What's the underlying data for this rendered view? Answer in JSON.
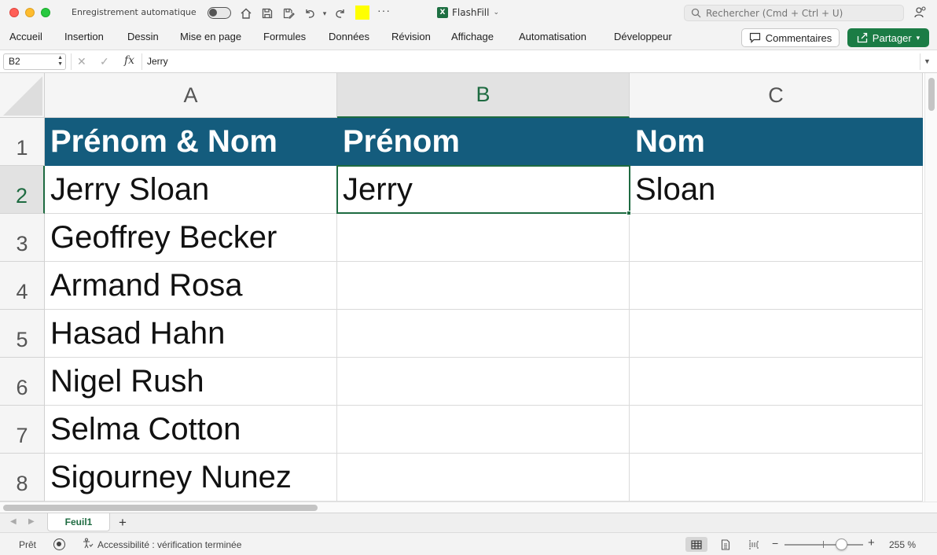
{
  "titlebar": {
    "autosave_label": "Enregistrement automatique",
    "doc_title": "FlashFill",
    "search_placeholder": "Rechercher (Cmd + Ctrl + U)",
    "highlight_color": "#ffff00"
  },
  "ribbon": {
    "tabs": [
      "Accueil",
      "Insertion",
      "Dessin",
      "Mise en page",
      "Formules",
      "Données",
      "Révision",
      "Affichage",
      "Automatisation",
      "Développeur"
    ],
    "comments_label": "Commentaires",
    "share_label": "Partager"
  },
  "formula_bar": {
    "name_box": "B2",
    "fx": "fx",
    "value": "Jerry"
  },
  "grid": {
    "columns": [
      "A",
      "B",
      "C"
    ],
    "rows": [
      "1",
      "2",
      "3",
      "4",
      "5",
      "6",
      "7",
      "8"
    ],
    "selected_column": "B",
    "selected_row": "2",
    "header_fill": "#145c7d",
    "cells": [
      [
        "Prénom & Nom",
        "Prénom",
        "Nom"
      ],
      [
        "Jerry Sloan",
        "Jerry",
        "Sloan"
      ],
      [
        "Geoffrey Becker",
        "",
        ""
      ],
      [
        "Armand Rosa",
        "",
        ""
      ],
      [
        "Hasad Hahn",
        "",
        ""
      ],
      [
        "Nigel Rush",
        "",
        ""
      ],
      [
        "Selma Cotton",
        "",
        ""
      ],
      [
        "Sigourney Nunez",
        "",
        ""
      ]
    ]
  },
  "sheets": {
    "active": "Feuil1",
    "add_label": "+"
  },
  "statusbar": {
    "ready": "Prêt",
    "accessibility": "Accessibilité : vérification terminée",
    "zoom_minus": "−",
    "zoom_plus": "+",
    "zoom_level": "255 %"
  }
}
